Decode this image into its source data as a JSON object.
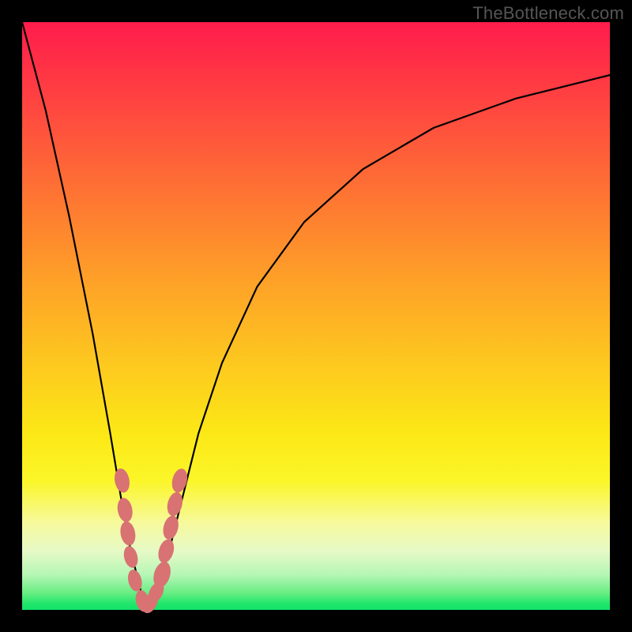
{
  "watermark": "TheBottleneck.com",
  "colors": {
    "frame": "#000000",
    "marker": "#d87273",
    "gradient_top": "#ff1c4c",
    "gradient_bottom": "#14e36a"
  },
  "chart_data": {
    "type": "line",
    "title": "",
    "xlabel": "",
    "ylabel": "",
    "xlim": [
      0,
      100
    ],
    "ylim": [
      0,
      100
    ],
    "grid": false,
    "legend": false,
    "series": [
      {
        "name": "bottleneck-curve",
        "note": "V-shaped bottleneck percentage curve; minimum near x≈21",
        "x": [
          0,
          4,
          8,
          12,
          15,
          17,
          18.5,
          20,
          21,
          22,
          23.5,
          25,
          27,
          30,
          34,
          40,
          48,
          58,
          70,
          84,
          100
        ],
        "values": [
          100,
          85,
          67,
          47,
          30,
          18,
          10,
          4,
          0,
          2,
          5,
          10,
          18,
          30,
          42,
          55,
          66,
          75,
          82,
          87,
          91
        ]
      }
    ],
    "markers": {
      "name": "highlighted-points",
      "note": "Pink lozenge markers clustered around the valley of the curve",
      "points": [
        {
          "x": 17.0,
          "y": 22,
          "r": 2.2
        },
        {
          "x": 17.5,
          "y": 17,
          "r": 2.2
        },
        {
          "x": 18.0,
          "y": 13,
          "r": 2.2
        },
        {
          "x": 18.5,
          "y": 9,
          "r": 2.0
        },
        {
          "x": 19.2,
          "y": 5,
          "r": 2.0
        },
        {
          "x": 20.5,
          "y": 1.5,
          "r": 2.0
        },
        {
          "x": 21.8,
          "y": 1.2,
          "r": 2.0
        },
        {
          "x": 22.8,
          "y": 3,
          "r": 2.0
        },
        {
          "x": 23.8,
          "y": 6,
          "r": 2.4
        },
        {
          "x": 24.5,
          "y": 10,
          "r": 2.2
        },
        {
          "x": 25.3,
          "y": 14,
          "r": 2.2
        },
        {
          "x": 26.0,
          "y": 18,
          "r": 2.2
        },
        {
          "x": 26.8,
          "y": 22,
          "r": 2.2
        }
      ]
    }
  }
}
